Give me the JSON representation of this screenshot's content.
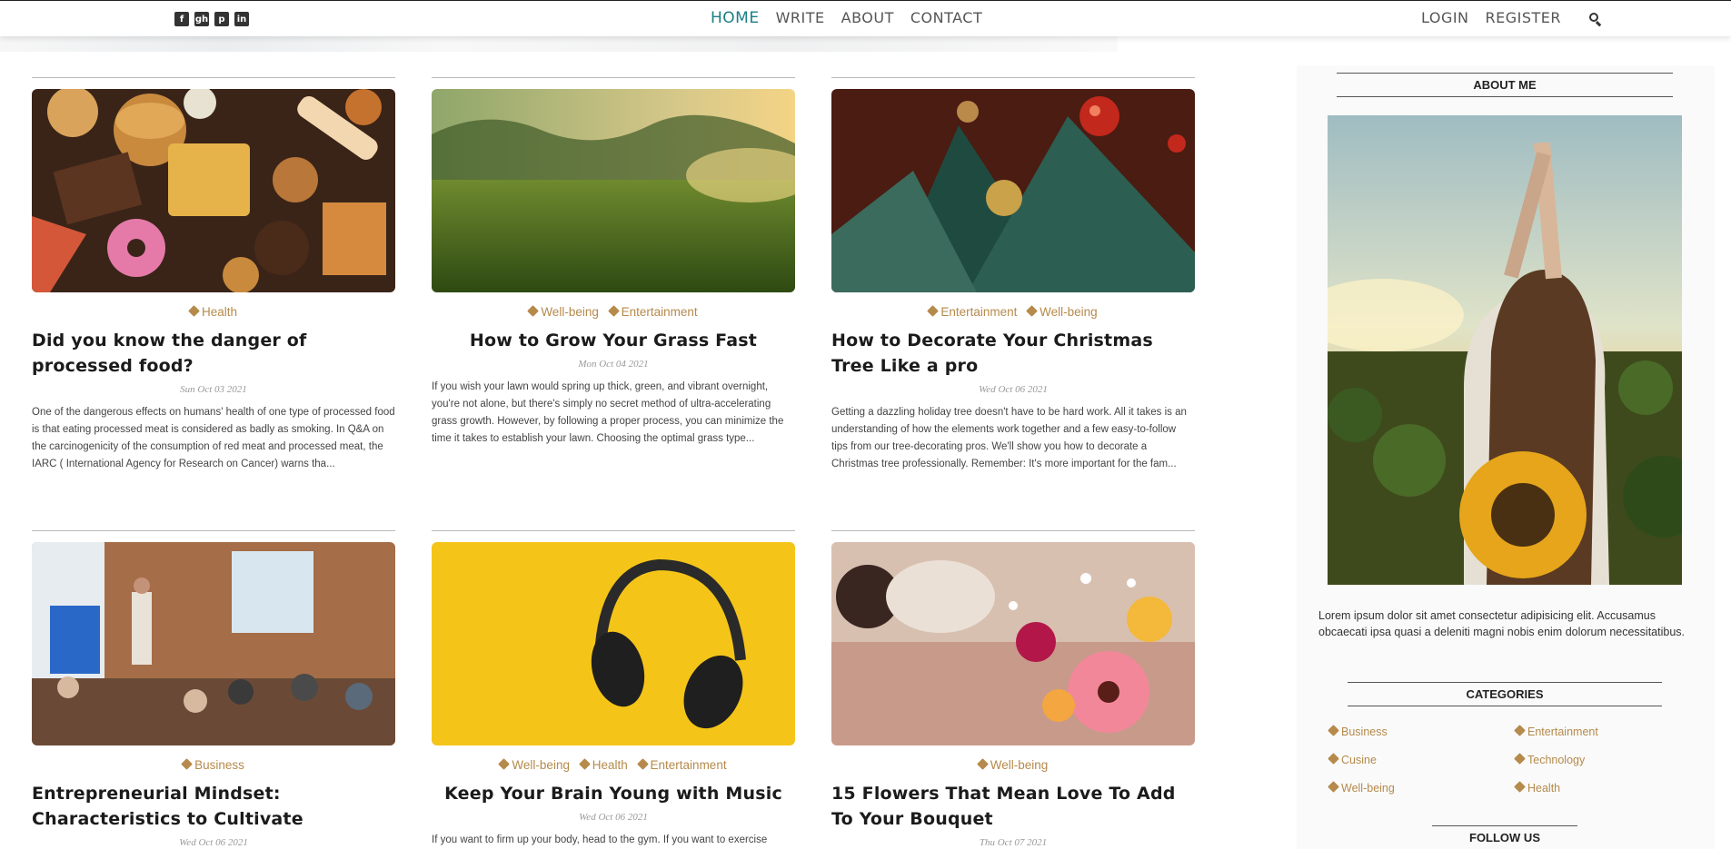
{
  "nav": {
    "social": [
      "f",
      "gh",
      "p",
      "in"
    ],
    "links": [
      "HOME",
      "WRITE",
      "ABOUT",
      "CONTACT"
    ],
    "login": "LOGIN",
    "register": "REGISTER"
  },
  "posts": [
    {
      "categories": [
        "Health"
      ],
      "title": "Did you know the danger of processed food?",
      "date": "Sun Oct 03 2021",
      "desc": "One of the dangerous effects on humans' health of one type of processed food is that eating processed meat is considered as badly as smoking. In Q&A on the carcinogenicity of the consumption of red meat and processed meat, the IARC ( International Agency for Research on Cancer) warns tha..."
    },
    {
      "categories": [
        "Well-being",
        "Entertainment"
      ],
      "title": "How to Grow Your Grass Fast",
      "date": "Mon Oct 04 2021",
      "desc": "If you wish your lawn would spring up thick, green, and vibrant overnight, you're not alone, but there's simply no secret method of ultra-accelerating grass growth. However, by following a proper process, you can minimize the time it takes to establish your lawn. Choosing the optimal grass type..."
    },
    {
      "categories": [
        "Entertainment",
        "Well-being"
      ],
      "title": "How to Decorate Your Christmas Tree Like a pro",
      "date": "Wed Oct 06 2021",
      "desc": "Getting a dazzling holiday tree doesn't have to be hard work. All it takes is an understanding of how the elements work together and a few easy-to-follow tips from our tree-decorating pros. We'll show you how to decorate a Christmas tree professionally. Remember: It's more important for the fam..."
    },
    {
      "categories": [
        "Business"
      ],
      "title": "Entrepreneurial Mindset: Characteristics to Cultivate",
      "date": "Wed Oct 06 2021",
      "desc": ""
    },
    {
      "categories": [
        "Well-being",
        "Health",
        "Entertainment"
      ],
      "title": "Keep Your Brain Young with Music",
      "date": "Wed Oct 06 2021",
      "desc": "If you want to firm up your body, head to the gym. If you want to exercise"
    },
    {
      "categories": [
        "Well-being"
      ],
      "title": "15 Flowers That Mean Love To Add To Your Bouquet",
      "date": "Thu Oct 07 2021",
      "desc": ""
    }
  ],
  "sidebar": {
    "about_title": "ABOUT ME",
    "about_text": "Lorem ipsum dolor sit amet consectetur adipisicing elit. Accusamus obcaecati ipsa quasi a deleniti magni nobis enim dolorum necessitatibus.",
    "categories_title": "CATEGORIES",
    "categories": [
      "Business",
      "Entertainment",
      "Cusine",
      "Technology",
      "Well-being",
      "Health"
    ],
    "follow_title": "FOLLOW US"
  },
  "colors": {
    "accent": "#1a7f83",
    "category": "#b58a4b"
  },
  "icons": [
    "facebook-icon",
    "github-icon",
    "pinterest-icon",
    "linkedin-icon",
    "search-icon",
    "tag-icon"
  ]
}
